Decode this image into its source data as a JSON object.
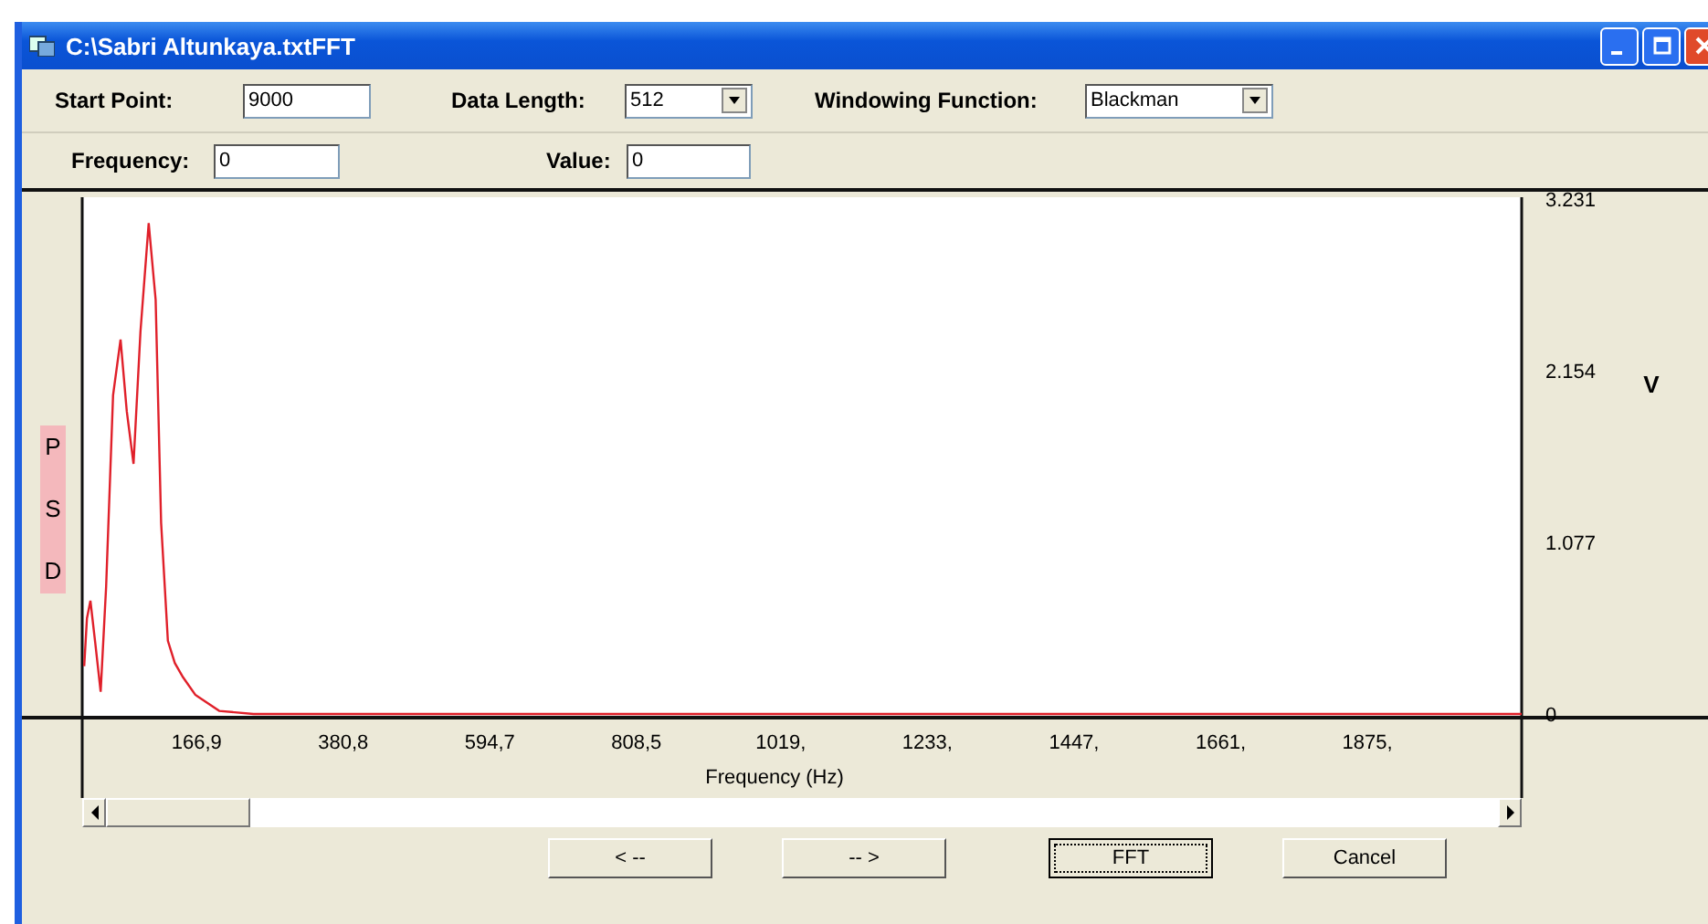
{
  "window": {
    "title": "C:\\Sabri Altunkaya.txtFFT"
  },
  "settings": [
    {
      "label": "Start Point:",
      "kind": "input",
      "value": "9000"
    },
    {
      "label": "Data Length:",
      "kind": "select",
      "value": "512"
    },
    {
      "label": "Windowing Function:",
      "kind": "select",
      "value": "Blackman"
    }
  ],
  "readouts": [
    {
      "label": "Frequency:",
      "value": "0"
    },
    {
      "label": "Value:",
      "value": "0"
    }
  ],
  "plot": {
    "unit": "V",
    "chart_data": {
      "type": "line",
      "xlabel": "Frequency (Hz)",
      "ylabel": "PSD",
      "xlim": [
        0,
        2100
      ],
      "ylim": [
        0,
        3.231
      ],
      "x": [
        3,
        7,
        12,
        19,
        27,
        35,
        45,
        56,
        65,
        75,
        85,
        97,
        107,
        115,
        125,
        135,
        147,
        165,
        200,
        250,
        400,
        800,
        2100
      ],
      "series": [
        {
          "color": "#e0202a",
          "values": [
            0.3,
            0.6,
            0.71,
            0.45,
            0.14,
            0.8,
            2.0,
            2.35,
            1.9,
            1.57,
            2.4,
            3.08,
            2.6,
            1.2,
            0.46,
            0.32,
            0.23,
            0.12,
            0.02,
            0.0,
            0.0,
            0.0,
            0.0
          ]
        }
      ],
      "xticks": [
        {
          "value": 166.9,
          "label": "166,9"
        },
        {
          "value": 380.8,
          "label": "380,8"
        },
        {
          "value": 594.7,
          "label": "594,7"
        },
        {
          "value": 808.5,
          "label": "808,5"
        },
        {
          "value": 1019,
          "label": "1019,"
        },
        {
          "value": 1233,
          "label": "1233,"
        },
        {
          "value": 1447,
          "label": "1447,"
        },
        {
          "value": 1661,
          "label": "1661,"
        },
        {
          "value": 1875,
          "label": "1875,"
        }
      ],
      "yticks": [
        0,
        1.077,
        2.154,
        3.231
      ]
    }
  },
  "buttons": [
    {
      "label": "< --",
      "focused": false
    },
    {
      "label": "-- >",
      "focused": false
    },
    {
      "label": "FFT",
      "focused": true
    },
    {
      "label": "Cancel",
      "focused": false
    }
  ]
}
